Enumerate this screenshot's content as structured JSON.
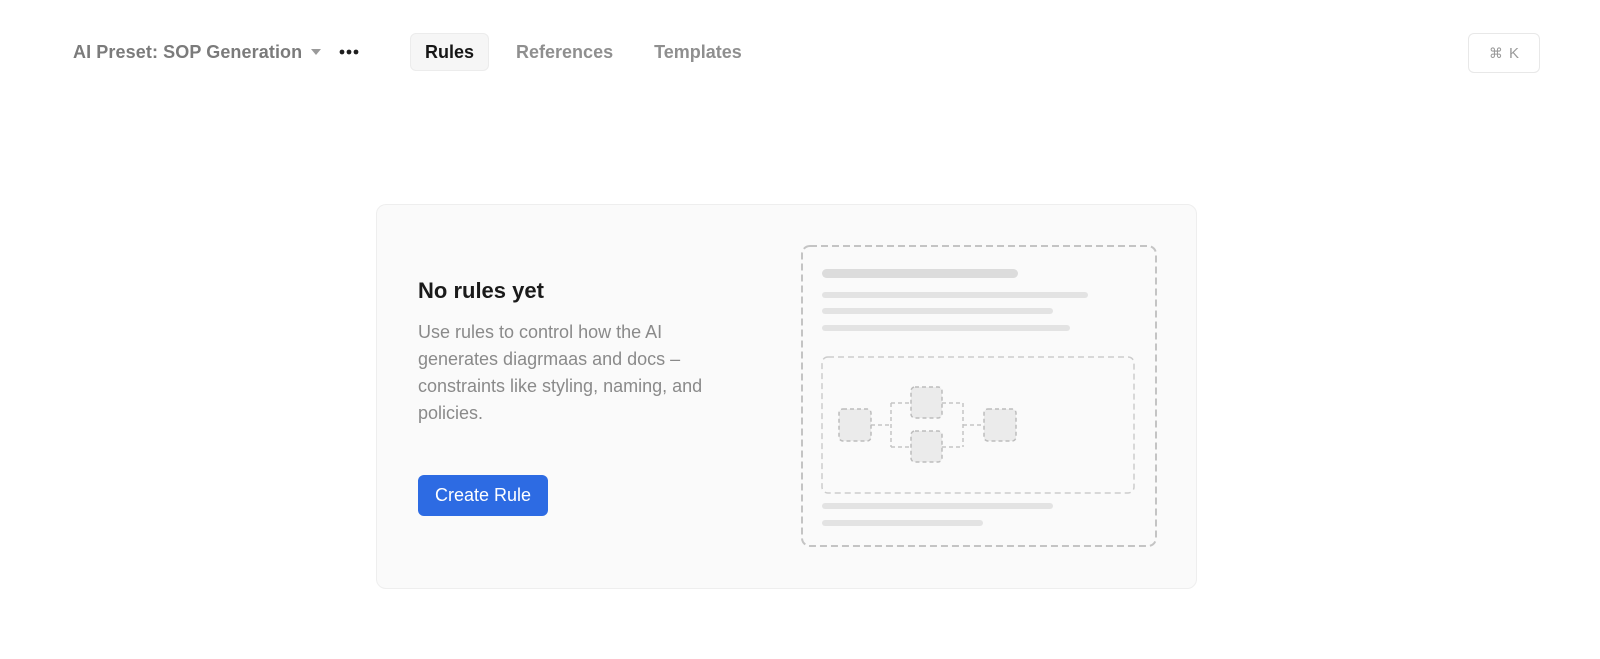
{
  "header": {
    "preset_label": "AI Preset: SOP Generation",
    "tabs": [
      {
        "label": "Rules",
        "active": true
      },
      {
        "label": "References",
        "active": false
      },
      {
        "label": "Templates",
        "active": false
      }
    ],
    "shortcut": {
      "glyph": "⌘",
      "key": "K"
    }
  },
  "empty_state": {
    "title": "No rules yet",
    "description": "Use rules to control how the AI generates diagrmaas and docs – constraints like styling, naming, and policies.",
    "button_label": "Create Rule"
  },
  "icons": {
    "preset_dropdown": "caret-down-icon",
    "more": "more-horizontal-icon",
    "illustration": "document-flowchart-placeholder-icon"
  },
  "colors": {
    "accent": "#2d6be3",
    "card_bg": "#fafafa",
    "muted_text": "#8a8a8a",
    "placeholder": "#d9d9d9"
  }
}
